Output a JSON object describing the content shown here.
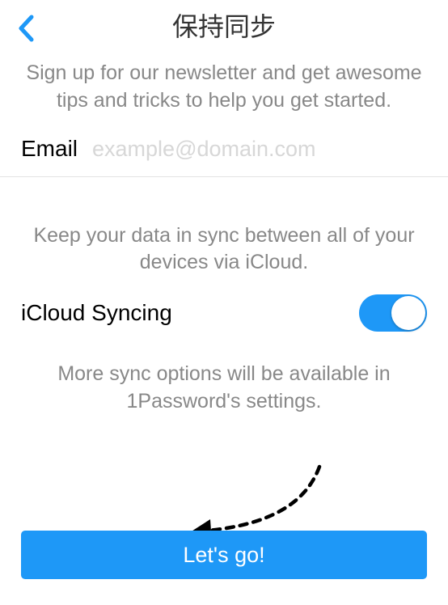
{
  "header": {
    "title": "保持同步"
  },
  "newsletter": {
    "subtitle": "Sign up for our newsletter and get awesome tips and tricks to help you get started.",
    "email_label": "Email",
    "email_placeholder": "example@domain.com",
    "email_value": ""
  },
  "sync": {
    "description": "Keep your data in sync between all of your devices via iCloud.",
    "label": "iCloud Syncing",
    "enabled": true,
    "more": "More sync options will be available in 1Password's settings."
  },
  "cta": {
    "label": "Let's go!"
  },
  "colors": {
    "accent": "#1e98f7",
    "muted": "#888888"
  }
}
